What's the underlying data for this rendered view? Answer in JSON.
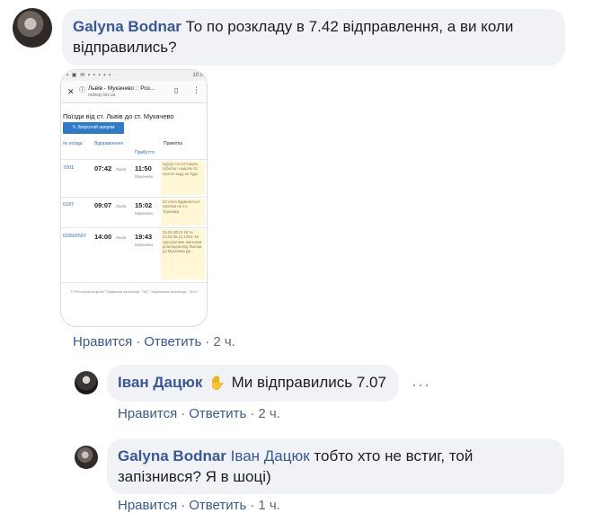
{
  "comments": [
    {
      "author": "Galyna Bodnar",
      "text_line1": "То по розкладу в 7.42 відправлення, а ви коли",
      "text_line2": "відправились?",
      "actions": {
        "like": "Нравится",
        "reply": "Ответить",
        "time": "2 ч."
      }
    },
    {
      "author": "Іван Дацюк",
      "text": "Ми відправились 7.07",
      "more": "···",
      "actions": {
        "like": "Нравится",
        "reply": "Ответить",
        "time": "2 ч."
      }
    },
    {
      "author": "Galyna Bodnar",
      "mention": "Іван Дацюк",
      "text_line1": "тобто хто не встиг, той",
      "text_line2": "запізнився? Я в шоці)",
      "actions": {
        "like": "Нравится",
        "reply": "Ответить",
        "time": "1 ч."
      }
    }
  ],
  "attachment": {
    "status_icons": "▪ ▣ ✉ ▪ ▪ ▪ ▪ ▪ ·",
    "status_time": "10:5",
    "page_title": "Львів - Мукачево :: Роз...",
    "url": "railway.lviv.ua",
    "heading": "Поїзди від ст. Львів до ст. Мукачево",
    "reverse_button": "↻ Зворотній напрям",
    "columns": [
      "№ поїзда",
      "Відправлення",
      "Прибуття",
      "Примітка"
    ],
    "rows": [
      {
        "num": "7001",
        "dep": "07:42",
        "dep_st": "Львів",
        "arr": "11:50",
        "arr_st": "Мукачево",
        "note": "Курсує по п'ятницях, суботах і неділях 01 лютого ходу не буде"
      },
      {
        "num": "6187",
        "dep": "09:07",
        "dep_st": "Львів",
        "arr": "15:02",
        "arr_st": "Мукачево",
        "note": "23 січня відміняється зупинка на з.п. Тернавка"
      },
      {
        "num": "6189/6507",
        "dep": "14:00",
        "dep_st": "Львів",
        "arr": "19:43",
        "arr_st": "Мукачево",
        "note": "28,29,30/12-18 та 03,04,05,12,13/01-19 курсуватиме зміненим розкладом Від Львова до Мукачева Дн..."
      }
    ],
    "footer": "© Регіональна філія \"Львівська залізниця\" ПАТ \"Українська залізниця\", 2019"
  },
  "colors": {
    "link": "#385898",
    "bubble": "#f0f2f5",
    "meta": "#606770"
  }
}
